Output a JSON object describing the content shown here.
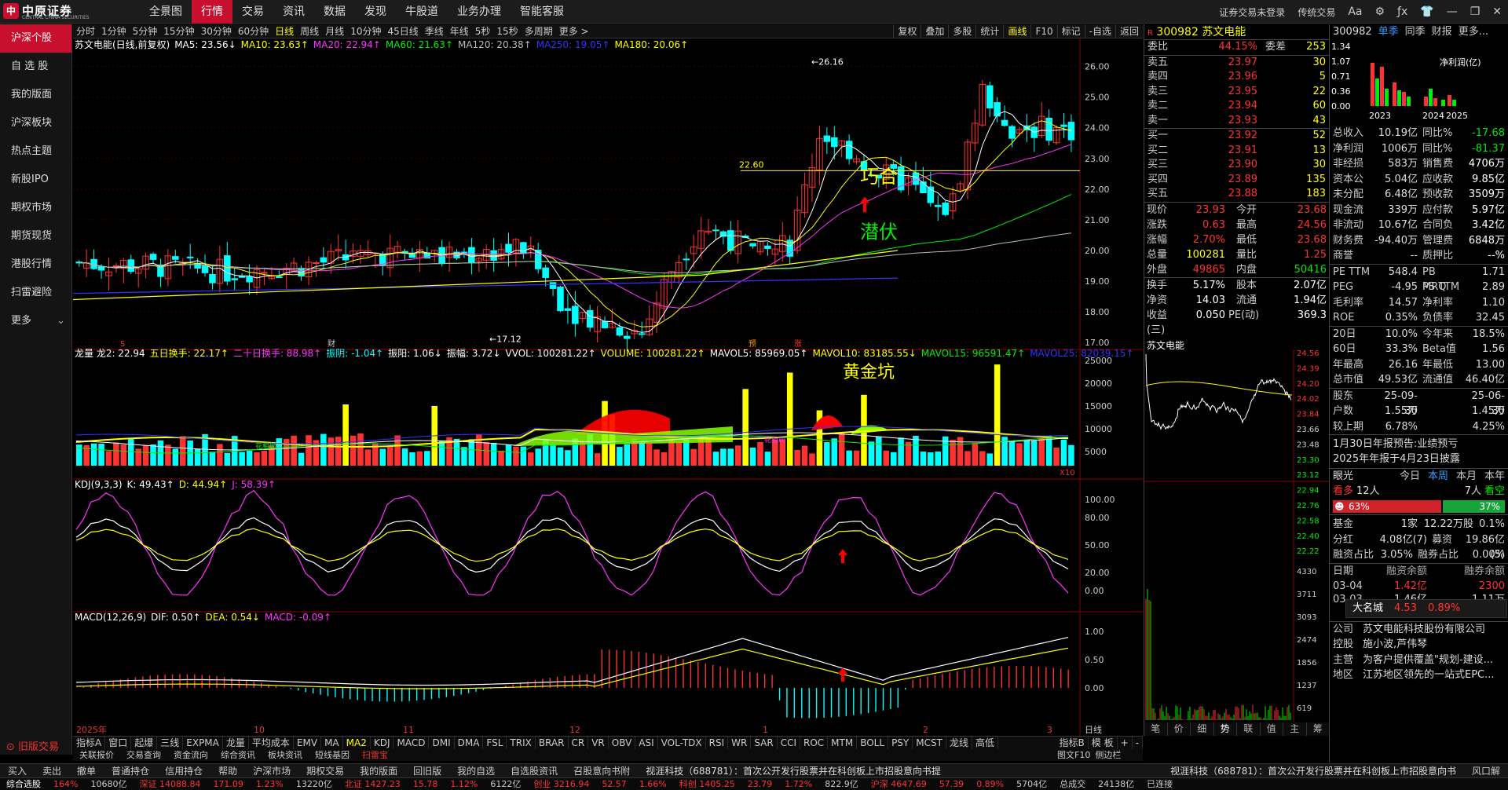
{
  "app": {
    "logo_text": "中原证券",
    "logo_sub": "CENTRAL CHINA SECURITIES",
    "top_nav": [
      "全景图",
      "行情",
      "交易",
      "资讯",
      "数据",
      "发现",
      "牛股道",
      "业务办理",
      "智能客服"
    ],
    "top_nav_active": 1,
    "top_right": [
      "证券交易未登录",
      "传统交易"
    ],
    "window_icons": [
      "font-size-icon",
      "gear-icon",
      "formula-icon",
      "shirt-icon",
      "minimize-icon",
      "restore-icon",
      "close-icon"
    ]
  },
  "left_nav": {
    "items": [
      "沪深个股",
      "自 选 股",
      "我的版面",
      "沪深板块",
      "热点主题",
      "新股IPO",
      "期权市场",
      "期货现货",
      "港股行情",
      "扫雷避险",
      "更多"
    ],
    "active": 0,
    "old_version": "旧版交易"
  },
  "toolbar": {
    "periods": [
      "分时",
      "1分钟",
      "5分钟",
      "15分钟",
      "30分钟",
      "60分钟",
      "日线",
      "周线",
      "月线",
      "10分钟",
      "45日线",
      "季线",
      "年线",
      "5秒",
      "15秒",
      "多周期",
      "更多 >"
    ],
    "active": 6,
    "right_tools": [
      "复权",
      "叠加",
      "多股",
      "统计",
      "画线",
      "F10",
      "标记",
      "-自选",
      "返回"
    ],
    "right_active": 4
  },
  "indicators": {
    "main": [
      {
        "t": "苏文电能(日线,前复权)",
        "c": "#fff"
      },
      {
        "t": "MA5: 23.56↓",
        "c": "#fff"
      },
      {
        "t": "MA10: 23.63↑",
        "c": "#ff0"
      },
      {
        "t": "MA20: 22.94↑",
        "c": "#f3f"
      },
      {
        "t": "MA60: 21.63↑",
        "c": "#0e0"
      },
      {
        "t": "MA120: 20.38↑",
        "c": "#bbb"
      },
      {
        "t": "MA250: 19.05↑",
        "c": "#33f"
      },
      {
        "t": "MA180: 20.06↑",
        "c": "#ff0"
      }
    ],
    "volume": [
      {
        "t": "龙量 龙2: 22.94",
        "c": "#fff"
      },
      {
        "t": "五日换手: 22.17↑",
        "c": "#ff0"
      },
      {
        "t": "二十日换手: 88.98↑",
        "c": "#f3f"
      },
      {
        "t": "振阴: -1.04↑",
        "c": "#0ff"
      },
      {
        "t": "振阳: 1.06↓",
        "c": "#fff"
      },
      {
        "t": "振幅: 3.72↓",
        "c": "#fff"
      },
      {
        "t": "VVOL: 100281.22↑",
        "c": "#fff"
      },
      {
        "t": "VOLUME: 100281.22↑",
        "c": "#ff0"
      },
      {
        "t": "MAVOL5: 85969.05↑",
        "c": "#fff"
      },
      {
        "t": "MAVOL10: 83185.55↓",
        "c": "#ff0"
      },
      {
        "t": "MAVOL15: 96591.47↑",
        "c": "#0e0"
      },
      {
        "t": "MAVOL25: 82039.15↑",
        "c": "#33f"
      }
    ],
    "kdj": [
      {
        "t": "KDJ(9,3,3)",
        "c": "#fff"
      },
      {
        "t": "K: 49.43↑",
        "c": "#fff"
      },
      {
        "t": "D: 44.94↑",
        "c": "#ff0"
      },
      {
        "t": "J: 58.39↑",
        "c": "#f3f"
      }
    ],
    "macd": [
      {
        "t": "MACD(12,26,9)",
        "c": "#fff"
      },
      {
        "t": "DIF: 0.50↑",
        "c": "#fff"
      },
      {
        "t": "DEA: 0.54↓",
        "c": "#ff0"
      },
      {
        "t": "MACD: -0.09↑",
        "c": "#f3f"
      }
    ]
  },
  "annotations": {
    "qiaohe": "巧合",
    "qianfu": "潜伏",
    "huangjinkeng": "黄金坑",
    "high_label": "26.16",
    "low_label": "17.12",
    "mid_label": "22.60",
    "event_s": "S",
    "event_cai": "财",
    "event_yu": "预",
    "event_zhang": "涨",
    "vol_text1": "花相助",
    "vol_text2": "花相助",
    "vol_x10": "X10"
  },
  "chart_data": {
    "type": "candlestick",
    "price_ylim": [
      16.8,
      26.5
    ],
    "price_ticks": [
      "26.00",
      "25.00",
      "24.00",
      "23.00",
      "22.00",
      "21.00",
      "20.00",
      "19.00",
      "18.00",
      "17.00"
    ],
    "volume_ticks": [
      "25000",
      "20000",
      "15000",
      "10000",
      "5000"
    ],
    "kdj_ticks": [
      "100.00",
      "80.00",
      "50.00",
      "20.00",
      "0.00"
    ],
    "macd_ticks": [
      "1.00",
      "0.50",
      "0.00"
    ],
    "x_labels": [
      "2025年",
      "10",
      "11",
      "12",
      "1",
      "2",
      "3"
    ],
    "x_label_right": "日线"
  },
  "bottom_tabs": {
    "items": [
      "指标A",
      "窗口",
      "起爆",
      "三线",
      "EXPMA",
      "龙量",
      "平均成本",
      "EMV",
      "MA",
      "MA2",
      "KDJ",
      "MACD",
      "DMI",
      "DMA",
      "FSL",
      "TRIX",
      "BRAR",
      "CR",
      "VR",
      "OBV",
      "ASI",
      "VOL-TDX",
      "RSI",
      "WR",
      "SAR",
      "CCI",
      "ROC",
      "MTM",
      "BOLL",
      "PSY",
      "MCST",
      "龙线",
      "高低"
    ],
    "active": 9,
    "right": [
      "指标B",
      "模 板",
      "+",
      "-"
    ]
  },
  "bottom_tabs2": [
    "关联报价",
    "交易查询",
    "资金流向",
    "综合资讯",
    "板块资讯",
    "短线基因",
    "扫雷宝"
  ],
  "quote": {
    "code": "300982",
    "name": "苏文电能",
    "weibi_label": "委比",
    "weibi": "44.15%",
    "weicha_label": "委差",
    "weicha": "253",
    "sell": [
      {
        "l": "卖五",
        "p": "23.97",
        "v": "30"
      },
      {
        "l": "卖四",
        "p": "23.96",
        "v": "5"
      },
      {
        "l": "卖三",
        "p": "23.95",
        "v": "22"
      },
      {
        "l": "卖二",
        "p": "23.94",
        "v": "60"
      },
      {
        "l": "卖一",
        "p": "23.93",
        "v": "43"
      }
    ],
    "buy": [
      {
        "l": "买一",
        "p": "23.92",
        "v": "52"
      },
      {
        "l": "买二",
        "p": "23.91",
        "v": "13"
      },
      {
        "l": "买三",
        "p": "23.90",
        "v": "30"
      },
      {
        "l": "买四",
        "p": "23.89",
        "v": "135"
      },
      {
        "l": "买五",
        "p": "23.88",
        "v": "183"
      }
    ],
    "stats": [
      {
        "a": "现价",
        "b": "23.93",
        "bc": "red",
        "c": "今开",
        "d": "23.68",
        "dc": "red"
      },
      {
        "a": "涨跌",
        "b": "0.63",
        "bc": "red",
        "c": "最高",
        "d": "24.56",
        "dc": "red"
      },
      {
        "a": "涨幅",
        "b": "2.70%",
        "bc": "red",
        "c": "最低",
        "d": "23.68",
        "dc": "red"
      },
      {
        "a": "总量",
        "b": "100281",
        "bc": "yellow",
        "c": "量比",
        "d": "1.25",
        "dc": "red"
      },
      {
        "a": "外盘",
        "b": "49865",
        "bc": "red",
        "c": "内盘",
        "d": "50416",
        "dc": "green"
      },
      {
        "a": "换手",
        "b": "5.17%",
        "bc": "white",
        "c": "股本",
        "d": "2.07亿",
        "dc": "white"
      },
      {
        "a": "净资",
        "b": "14.03",
        "bc": "white",
        "c": "流通",
        "d": "1.94亿",
        "dc": "white"
      },
      {
        "a": "收益(三)",
        "b": "0.050",
        "bc": "white",
        "c": "PE(动)",
        "d": "369.3",
        "dc": "white"
      }
    ],
    "tick_title": "苏文电能",
    "tick_ticks": [
      "24.56",
      "24.39",
      "24.20",
      "24.02",
      "23.84",
      "23.66",
      "23.48",
      "23.30",
      "23.12",
      "22.94",
      "22.76",
      "22.58",
      "22.40",
      "22.22"
    ],
    "tick_vol_ticks": [
      "4330",
      "3711",
      "3093",
      "2474",
      "1856",
      "1237",
      "619"
    ],
    "tabs": [
      "笔",
      "价",
      "细",
      "势",
      "联",
      "值",
      "主",
      "筹"
    ]
  },
  "fin": {
    "code": "300982",
    "tabs": [
      "单季",
      "同季",
      "财报",
      "更多..."
    ],
    "bar_ticks": [
      "1.34",
      "1.07",
      "0.71",
      "0.36",
      "0.00"
    ],
    "bar_title": "净利润(亿)",
    "years": [
      "2023",
      "2024",
      "2025"
    ],
    "rows1": [
      {
        "a": "总收入",
        "b": "10.19亿",
        "c": "同比%",
        "d": "-17.68",
        "dc": "green"
      },
      {
        "a": "净利润",
        "b": "1006万",
        "c": "同比%",
        "d": "-81.37",
        "dc": "green"
      },
      {
        "a": "非经损",
        "b": "583万",
        "c": "销售费",
        "d": "4706万",
        "dc": "white"
      },
      {
        "a": "资本公",
        "b": "5.04亿",
        "c": "应收款",
        "d": "9.85亿",
        "dc": "white"
      },
      {
        "a": "未分配",
        "b": "6.48亿",
        "c": "预收款",
        "d": "3509万",
        "dc": "white"
      },
      {
        "a": "现金流",
        "b": "339万",
        "c": "应付款",
        "d": "5.97亿",
        "dc": "white"
      },
      {
        "a": "非流动",
        "b": "10.67亿",
        "c": "合同负",
        "d": "3.42亿",
        "dc": "white"
      },
      {
        "a": "财务费",
        "b": "-94.40万",
        "c": "管理费",
        "d": "6848万",
        "dc": "white"
      },
      {
        "a": "商誉",
        "b": "--",
        "c": "质押比",
        "d": "--%",
        "dc": "white"
      }
    ],
    "rows2": [
      {
        "a": "PE TTM",
        "b": "548.4",
        "c": "PB MRQ",
        "d": "1.71"
      },
      {
        "a": "PEG",
        "b": "-4.95",
        "c": "PS TTM",
        "d": "2.89"
      },
      {
        "a": "毛利率",
        "b": "14.57",
        "c": "净利率",
        "d": "1.10"
      },
      {
        "a": "ROE",
        "b": "0.35%",
        "c": "负债率",
        "d": "32.45"
      }
    ],
    "rows3": [
      {
        "a": "20日",
        "b": "10.0%",
        "c": "今年来",
        "d": "18.5%"
      },
      {
        "a": "60日",
        "b": "33.3%",
        "c": "Beta值",
        "d": "1.56"
      },
      {
        "a": "年最高",
        "b": "26.16",
        "c": "年最低",
        "d": "13.00"
      },
      {
        "a": "总市值",
        "b": "49.53亿",
        "c": "流通值",
        "d": "46.40亿"
      }
    ],
    "rows4": [
      {
        "a": "股东",
        "b": "25-09-30",
        "d": "25-06-30"
      },
      {
        "a": "户数",
        "b": "1.55万",
        "d": "1.45万"
      },
      {
        "a": "较上期",
        "b": "6.78%",
        "d": "4.25%"
      }
    ],
    "notice1": "1月30日年报预告:业绩预亏",
    "notice2": "2025年年报于4月23日披露",
    "eye_label": "眼光",
    "eye_tabs": [
      "今日",
      "本周",
      "本月",
      "本年"
    ],
    "bull_label": "看多",
    "bull_count": "12人",
    "bear_count": "7人",
    "bear_label": "看空",
    "bull_pct": "63%",
    "bear_pct": "37%",
    "bull_fraction": 0.63,
    "fund_label": "基金",
    "fund_a": "1家",
    "fund_b": "12.22万股",
    "fund_c": "0.1%",
    "div_label": "分红",
    "div_a": "4.08亿(7)",
    "div_b": "募资",
    "div_c": "19.86亿(5)",
    "margin_label": "融资占比",
    "margin_a": "3.05%",
    "margin_b": "融券占比",
    "margin_c": "0.00%",
    "table_head": [
      "日期",
      "融资余额",
      "融券余额"
    ],
    "table_row": [
      "03-04",
      "1.42亿",
      "2300"
    ],
    "table_row2": [
      "03-03",
      "1.46亿",
      "1.11万"
    ],
    "dmc_label": "大名城",
    "dmc_price": "4.53",
    "dmc_pct": "0.89%",
    "company_rows": [
      {
        "a": "公司",
        "b": "苏文电能科技股份有限公司"
      },
      {
        "a": "控股",
        "b": "施小波,芦伟琴"
      },
      {
        "a": "主营",
        "b": "为客户提供覆盖\"规划-建设..."
      },
      {
        "a": "地区",
        "b": "江苏地区领先的一站式EPC..."
      }
    ]
  },
  "funcbar": {
    "items": [
      "买入",
      "卖出",
      "撤单",
      "普通持仓",
      "信用持仓",
      "帮助",
      "沪深市场",
      "期权交易",
      "我的版面",
      "回旧版",
      "我的自选",
      "自选股资讯",
      "召股意向书附"
    ],
    "news1": "视涯科技（688781）：首次公开发行股票并在科创板上市招股意向书提",
    "news2": "视涯科技（688781）：首次公开发行股票并在科创板上市招股意向书",
    "right": "图文F10",
    "right2": "侧边栏",
    "right3": "风口解"
  },
  "statusbar": [
    {
      "t": "综合选股",
      "c": "#fff"
    },
    {
      "t": "164%",
      "c": "#f33"
    },
    {
      "t": "10680亿",
      "c": "#ccc"
    },
    {
      "t": "深证 14088.84",
      "c": "#f33"
    },
    {
      "t": "171.09",
      "c": "#f33"
    },
    {
      "t": "1.23%",
      "c": "#f33"
    },
    {
      "t": "13220亿",
      "c": "#ccc"
    },
    {
      "t": "北证 1427.23",
      "c": "#f33"
    },
    {
      "t": "15.78",
      "c": "#f33"
    },
    {
      "t": "1.12%",
      "c": "#f33"
    },
    {
      "t": "6122亿",
      "c": "#ccc"
    },
    {
      "t": "创业 3216.94",
      "c": "#f33"
    },
    {
      "t": "52.57",
      "c": "#f33"
    },
    {
      "t": "1.66%",
      "c": "#f33"
    },
    {
      "t": "科创 1405.25",
      "c": "#f33"
    },
    {
      "t": "23.79",
      "c": "#f33"
    },
    {
      "t": "1.72%",
      "c": "#f33"
    },
    {
      "t": "822.9亿",
      "c": "#ccc"
    },
    {
      "t": "沪深 4647.69",
      "c": "#f33"
    },
    {
      "t": "57.39",
      "c": "#f33"
    },
    {
      "t": "0.89%",
      "c": "#f33"
    },
    {
      "t": "5704亿",
      "c": "#ccc"
    },
    {
      "t": "总成交",
      "c": "#ccc"
    },
    {
      "t": "24138亿",
      "c": "#ccc"
    },
    {
      "t": "已连接",
      "c": "#ccc"
    }
  ]
}
